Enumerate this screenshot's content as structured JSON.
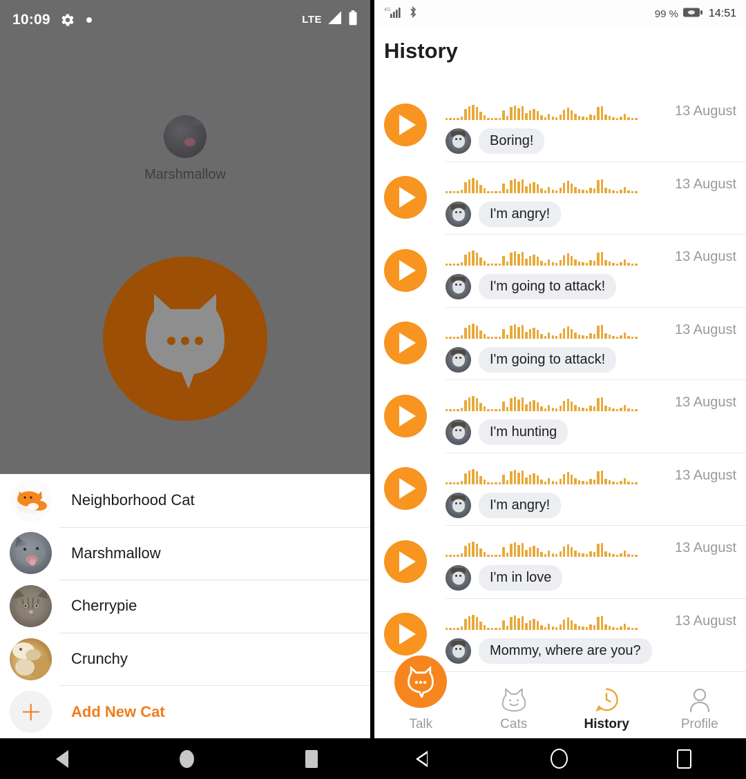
{
  "left_phone": {
    "status_bar": {
      "time": "10:09",
      "gear_icon": "gear-icon",
      "dot_icon": "notification-dot-icon",
      "network": "LTE",
      "signal_icon": "signal-icon",
      "battery_icon": "battery-icon"
    },
    "hero": {
      "selected_cat": "Marshmallow",
      "avatar_icon": "cat-photo-avatar",
      "logo_icon": "cat-speech-bubble-logo",
      "logo_color": "#9d4f05"
    },
    "cat_sheet": {
      "items": [
        {
          "label": "Neighborhood Cat",
          "avatar": "orange-cartoon-cat-avatar"
        },
        {
          "label": "Marshmallow",
          "avatar": "gray-cat-photo-avatar"
        },
        {
          "label": "Cherrypie",
          "avatar": "tabby-cat-photo-avatar"
        },
        {
          "label": "Crunchy",
          "avatar": "cream-cat-photo-avatar"
        }
      ],
      "add_new": {
        "label": "Add New Cat",
        "icon": "plus-icon",
        "color": "#f07c1e"
      }
    }
  },
  "right_phone": {
    "status_bar": {
      "signal_icon": "signal-bars-icon",
      "bluetooth_icon": "bluetooth-icon",
      "battery_percent": "99 %",
      "battery_icon": "battery-icon",
      "time": "14:51"
    },
    "title": "History",
    "history": {
      "play_icon": "play-icon",
      "accent_color": "#f79520",
      "waveform_color": "#e8a93a",
      "items": [
        {
          "message": "Boring!",
          "date": "13 August",
          "avatar": "cat-photo-avatar"
        },
        {
          "message": "I'm angry!",
          "date": "13 August",
          "avatar": "cat-photo-avatar"
        },
        {
          "message": "I'm going to attack!",
          "date": "13 August",
          "avatar": "cat-photo-avatar"
        },
        {
          "message": "I'm going to attack!",
          "date": "13 August",
          "avatar": "cat-photo-avatar"
        },
        {
          "message": "I'm hunting",
          "date": "13 August",
          "avatar": "cat-photo-avatar"
        },
        {
          "message": "I'm angry!",
          "date": "13 August",
          "avatar": "cat-photo-avatar"
        },
        {
          "message": "I'm in love",
          "date": "13 August",
          "avatar": "cat-photo-avatar"
        },
        {
          "message": "Mommy, where are you?",
          "date": "13 August",
          "avatar": "cat-photo-avatar"
        }
      ],
      "waveform_heights": [
        3,
        3,
        3,
        3,
        5,
        16,
        20,
        22,
        19,
        12,
        7,
        3,
        3,
        3,
        3,
        14,
        6,
        19,
        21,
        17,
        20,
        10,
        14,
        16,
        13,
        7,
        4,
        9,
        5,
        4,
        8,
        15,
        18,
        14,
        9,
        6,
        5,
        4,
        8,
        7,
        19,
        20,
        8,
        6,
        4,
        3,
        5,
        9,
        4,
        3,
        3
      ]
    },
    "bottom_nav": [
      {
        "label": "Talk",
        "icon": "cat-bubble-icon",
        "active": false,
        "fab": true
      },
      {
        "label": "Cats",
        "icon": "cat-face-outline-icon",
        "active": false,
        "fab": false
      },
      {
        "label": "History",
        "icon": "clock-bubble-icon",
        "active": true,
        "fab": false
      },
      {
        "label": "Profile",
        "icon": "person-outline-icon",
        "active": false,
        "fab": false
      }
    ]
  },
  "system_nav": {
    "left": [
      {
        "icon": "back-icon"
      },
      {
        "icon": "home-icon"
      },
      {
        "icon": "recents-icon"
      }
    ],
    "right": [
      {
        "icon": "back-icon"
      },
      {
        "icon": "home-icon"
      },
      {
        "icon": "recents-icon"
      }
    ]
  }
}
